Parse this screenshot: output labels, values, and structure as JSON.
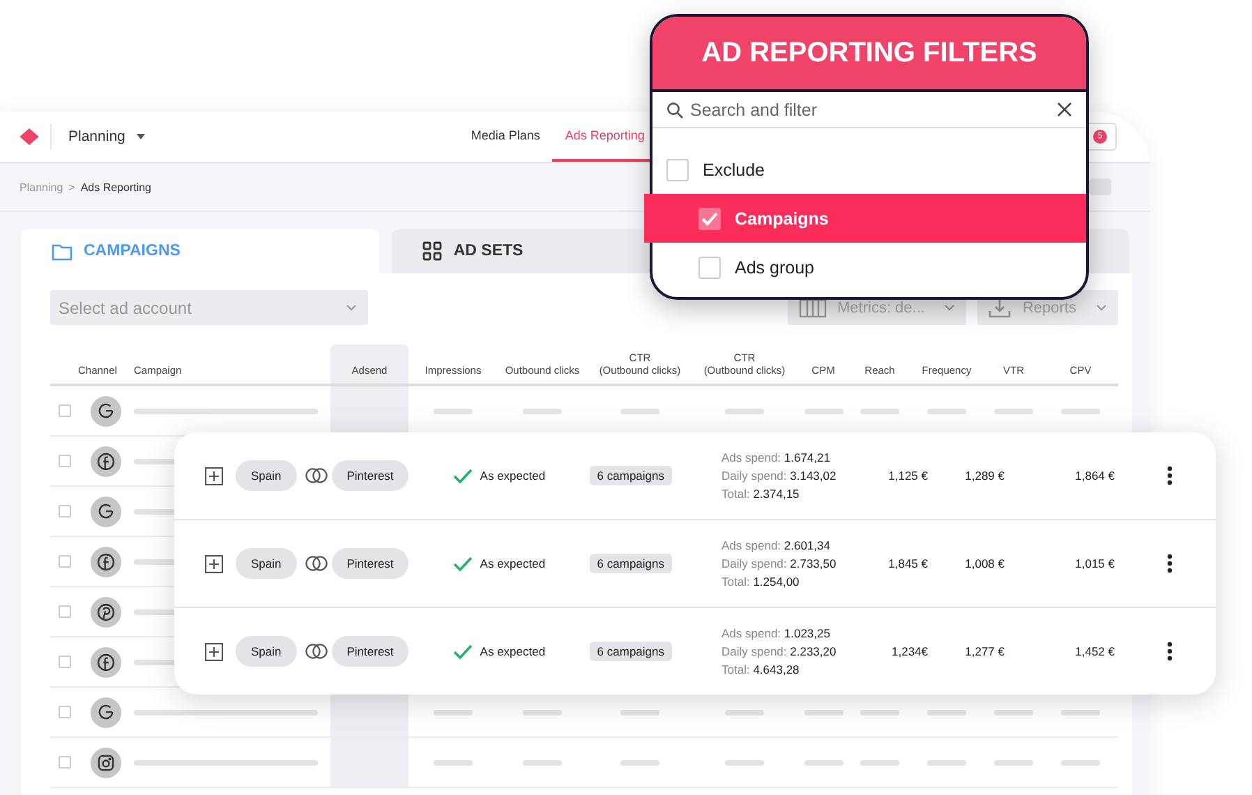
{
  "header": {
    "workspace": "Planning",
    "nav": [
      {
        "label": "Media Plans",
        "selected": false
      },
      {
        "label": "Ads Reporting",
        "selected": true
      }
    ],
    "notifications": "5"
  },
  "breadcrumb": {
    "items": [
      "Planning",
      "Ads Reporting"
    ],
    "separator": ">"
  },
  "tabs": [
    {
      "label": "CAMPAIGNS",
      "selected": true
    },
    {
      "label": "AD SETS",
      "selected": false
    }
  ],
  "account_select": {
    "placeholder": "Select ad account"
  },
  "toolbar": {
    "metrics": "Metrics: de...",
    "reports": "Reports"
  },
  "table": {
    "columns": [
      "Channel",
      "Campaign",
      "Adsend",
      "Impressions",
      "Outbound clicks",
      "CTR\n(Outbound clicks)",
      "CTR\n(Outbound clicks)",
      "CPM",
      "Reach",
      "Frequency",
      "VTR",
      "CPV"
    ],
    "rows": [
      {
        "kind": "google",
        "checked": false
      },
      {
        "kind": "facebook",
        "checked": false
      },
      {
        "kind": "google",
        "checked": false
      },
      {
        "kind": "facebook",
        "checked": false
      },
      {
        "kind": "pinterest",
        "checked": false
      },
      {
        "kind": "facebook",
        "checked": false
      },
      {
        "kind": "google",
        "checked": false
      },
      {
        "kind": "instagram",
        "checked": false
      }
    ]
  },
  "ad_groups": [
    {
      "country": "Spain",
      "platform": "Pinterest",
      "status": "As expected",
      "campaigns": "6 campaigns",
      "spend": [
        {
          "label": "Ads spend:",
          "value": "1.674,21"
        },
        {
          "label": "Daily spend:",
          "value": "3.143,02"
        },
        {
          "label": "Total:",
          "value": "2.374,15"
        }
      ],
      "metrics": [
        "1,125 €",
        "1,289 €",
        "1,864 €"
      ]
    },
    {
      "country": "Spain",
      "platform": "Pinterest",
      "status": "As expected",
      "campaigns": "6 campaigns",
      "spend": [
        {
          "label": "Ads spend:",
          "value": "2.601,34"
        },
        {
          "label": "Daily spend:",
          "value": "2.733,50"
        },
        {
          "label": "Total:",
          "value": "1.254,00"
        }
      ],
      "metrics": [
        "1,845 €",
        "1,008 €",
        "1,015 €"
      ]
    },
    {
      "country": "Spain",
      "platform": "Pinterest",
      "status": "As expected",
      "campaigns": "6 campaigns",
      "spend": [
        {
          "label": "Ads spend:",
          "value": "1.023,25"
        },
        {
          "label": "Daily spend:",
          "value": "2.233,20"
        },
        {
          "label": "Total:",
          "value": "4.643,28"
        }
      ],
      "metrics": [
        "1,234€",
        "1,277 €",
        "1,452 €"
      ]
    }
  ],
  "filters": {
    "title": "AD REPORTING FILTERS",
    "search_placeholder": "Search and filter",
    "items": [
      {
        "label": "Exclude",
        "checked": false,
        "selected": false,
        "children": [
          {
            "label": "Campaigns",
            "checked": true,
            "selected": true
          },
          {
            "label": "Ads group",
            "checked": false,
            "selected": false
          }
        ]
      }
    ]
  }
}
